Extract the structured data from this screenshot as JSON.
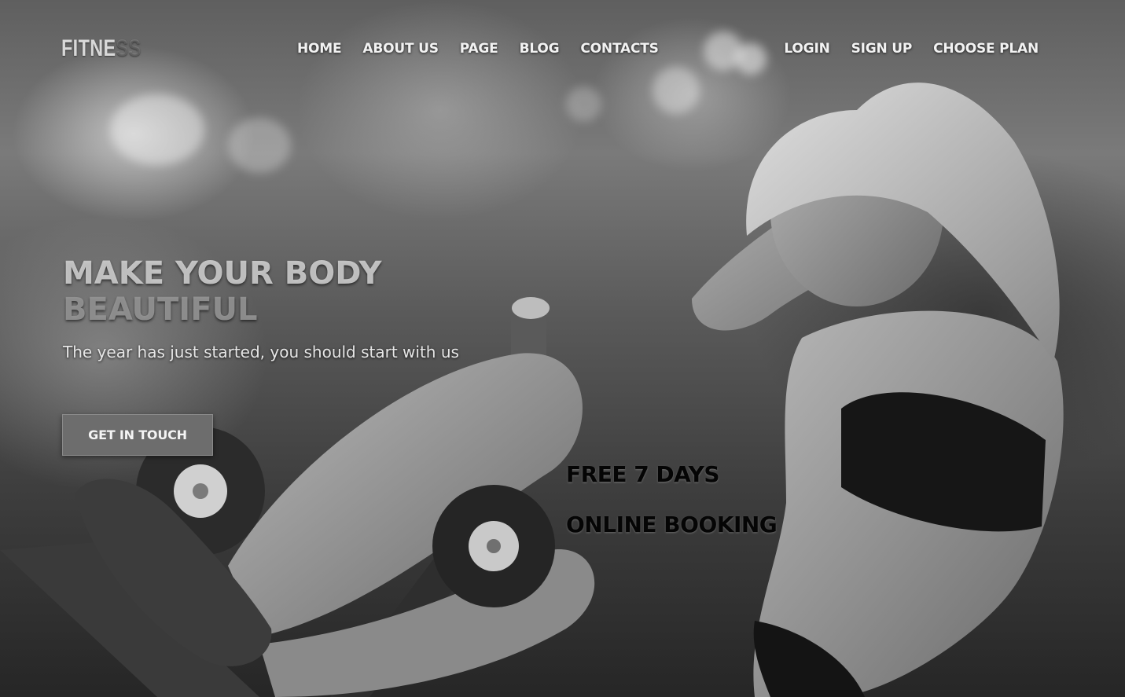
{
  "header": {
    "logo_main": "FITNE",
    "logo_faded": "SS",
    "nav_main": [
      {
        "label": "HOME"
      },
      {
        "label": "ABOUT US"
      },
      {
        "label": "PAGE"
      },
      {
        "label": "BLOG"
      },
      {
        "label": "CONTACTS"
      }
    ],
    "nav_right": [
      {
        "label": "LOGIN"
      },
      {
        "label": "SIGN UP"
      },
      {
        "label": "CHOOSE PLAN"
      }
    ]
  },
  "hero": {
    "title_line1": "MAKE YOUR BODY",
    "title_line2": "BEAUTIFUL",
    "subtitle": "The year has just started, you should start with us",
    "cta_label": "GET IN TOUCH"
  },
  "promo": {
    "line1": "FREE 7 DAYS",
    "line2": "ONLINE BOOKING"
  },
  "theme": {
    "background": "#4a4a4a",
    "button_bg": "#6d6d6d",
    "promo_text": "#050505"
  }
}
